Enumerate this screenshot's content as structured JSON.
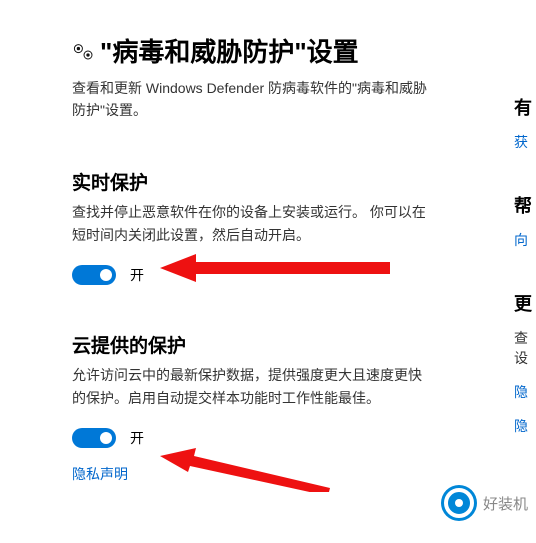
{
  "page": {
    "title": "\"病毒和威胁防护\"设置",
    "desc": "查看和更新 Windows Defender 防病毒软件的\"病毒和威胁防护\"设置。"
  },
  "sections": {
    "realtime": {
      "title": "实时保护",
      "desc": "查找并停止恶意软件在你的设备上安装或运行。 你可以在短时间内关闭此设置，然后自动开启。",
      "toggle_label": "开"
    },
    "cloud": {
      "title": "云提供的保护",
      "desc": "允许访问云中的最新保护数据，提供强度更大且速度更快的保护。启用自动提交样本功能时工作性能最佳。",
      "toggle_label": "开",
      "privacy_link": "隐私声明"
    }
  },
  "rightcol": {
    "g1_head": "有",
    "g1_link": "获",
    "g2_head": "帮",
    "g2_link": "向",
    "g3_head": "更",
    "g3_text1": "查",
    "g3_text2": "设",
    "g3_link1": "隐",
    "g3_link2": "隐"
  },
  "watermark": {
    "text": "好装机"
  }
}
